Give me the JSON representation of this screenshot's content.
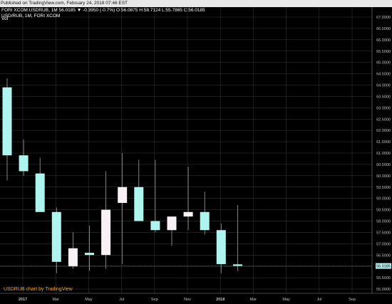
{
  "header": {
    "published": "Published on TradingView.com, February 24, 2018 07:46 EST",
    "ohlc_line": "FORI XCOM:USDRUB, 1M 56.0185 ▼ -0.3950 (-0.7%) O:56.0875 H:58.7124 L:55.7865 C:56.0185",
    "symbol_line": "USD/RUB, 1M, FORI XCOM",
    "volume_label": "Vol"
  },
  "watermark": "USDRUB chart by TradingView",
  "price_tag": "56.0185",
  "colors": {
    "background": "#000000",
    "bull_candle": "#f7f0f4",
    "bear_candle": "#aef5f0",
    "wick": "#a0a0a0",
    "grid": "#3a3a3a",
    "axis_text": "#c0c0c0",
    "price_tag_bg": "#b8f0f0",
    "watermark": "#f0a030"
  },
  "chart_data": {
    "type": "candlestick",
    "title": "",
    "ylim": [
      55.0,
      67.0
    ],
    "y_ticks": [
      "67.0000",
      "66.5000",
      "66.0000",
      "65.5000",
      "65.0000",
      "64.5000",
      "64.0000",
      "63.5000",
      "63.0000",
      "62.5000",
      "62.0000",
      "61.5000",
      "61.0000",
      "60.5000",
      "60.0000",
      "59.5000",
      "59.0000",
      "58.5000",
      "58.0000",
      "57.5000",
      "57.0000",
      "56.5000",
      "56.0000",
      "55.5000",
      "55.0000"
    ],
    "x_ticks": [
      "2017",
      "Mar",
      "May",
      "Jul",
      "Sep",
      "Nov",
      "2018",
      "Mar",
      "May",
      "Jul",
      "Sep"
    ],
    "x_tick_month_index": [
      0,
      2,
      4,
      6,
      8,
      10,
      12,
      14,
      16,
      18,
      20
    ],
    "n_slots": 21,
    "candles": [
      {
        "month": "2016-11",
        "open": 63.9,
        "high": 64.3,
        "low": 59.8,
        "close": 60.9
      },
      {
        "month": "2016-12",
        "open": 60.9,
        "high": 61.6,
        "low": 60.0,
        "close": 60.2
      },
      {
        "month": "2017-01",
        "open": 60.1,
        "high": 60.8,
        "low": 58.4,
        "close": 58.4
      },
      {
        "month": "2017-02",
        "open": 58.4,
        "high": 58.6,
        "low": 55.7,
        "close": 56.2
      },
      {
        "month": "2017-03",
        "open": 56.0,
        "high": 57.5,
        "low": 55.9,
        "close": 56.8
      },
      {
        "month": "2017-04",
        "open": 56.6,
        "high": 57.8,
        "low": 55.8,
        "close": 56.5
      },
      {
        "month": "2017-05",
        "open": 56.5,
        "high": 60.2,
        "low": 55.9,
        "close": 58.5
      },
      {
        "month": "2017-06",
        "open": 58.8,
        "high": 61.0,
        "low": 56.1,
        "close": 59.5
      },
      {
        "month": "2017-07",
        "open": 59.5,
        "high": 60.7,
        "low": 58.1,
        "close": 58.0
      },
      {
        "month": "2017-08",
        "open": 58.0,
        "high": 60.7,
        "low": 57.5,
        "close": 57.6
      },
      {
        "month": "2017-09",
        "open": 57.6,
        "high": 58.1,
        "low": 56.9,
        "close": 58.2
      },
      {
        "month": "2017-10",
        "open": 58.2,
        "high": 60.4,
        "low": 57.6,
        "close": 58.4
      },
      {
        "month": "2017-11",
        "open": 58.4,
        "high": 59.3,
        "low": 57.4,
        "close": 57.6
      },
      {
        "month": "2017-12",
        "open": 57.6,
        "high": 57.9,
        "low": 55.7,
        "close": 56.1
      },
      {
        "month": "2018-01",
        "open": 56.09,
        "high": 58.71,
        "low": 55.79,
        "close": 56.02
      }
    ],
    "last_price": 56.0185,
    "last_price_label": "56.0185",
    "grid": true
  }
}
